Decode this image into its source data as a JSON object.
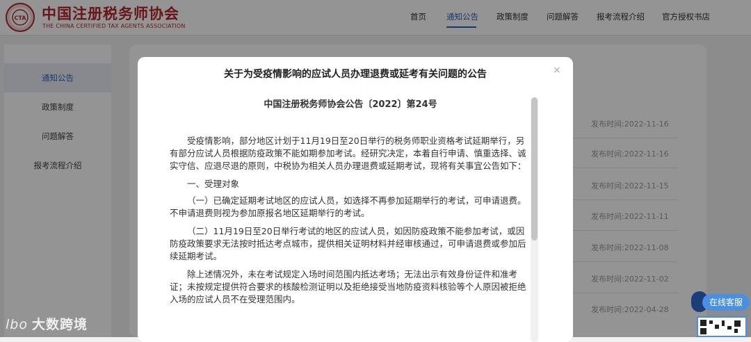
{
  "header": {
    "org_name": "中国注册税务师协会",
    "org_name_en": "THE CHINA CERTIFIED TAX AGENTS ASSOCIATION",
    "logo_text": "CTA",
    "nav": [
      {
        "label": "首页"
      },
      {
        "label": "通知公告",
        "active": true
      },
      {
        "label": "政策制度"
      },
      {
        "label": "问题解答"
      },
      {
        "label": "报考流程介绍"
      },
      {
        "label": "官方授权书店"
      }
    ]
  },
  "sidebar": {
    "items": [
      {
        "label": "通知公告",
        "active": true
      },
      {
        "label": "政策制度"
      },
      {
        "label": "问题解答"
      },
      {
        "label": "报考流程介绍"
      }
    ]
  },
  "list": {
    "dates": [
      "发布时间:2022-11-16",
      "发布时间:2022-11-16",
      "发布时间:2022-11-15",
      "发布时间:2022-11-11",
      "发布时间:2022-11-08",
      "发布时间:2022-11-02",
      "发布时间:2022-04-28"
    ]
  },
  "modal": {
    "title": "关于为受疫情影响的应试人员办理退费或延考有关问题的公告",
    "close_label": "×",
    "doc_number": "中国注册税务师协会公告〔2022〕第24号",
    "paragraphs": [
      "受疫情影响，部分地区计划于11月19日至20日举行的税务师职业资格考试延期举行，另有部分应试人员根据防疫政策不能如期参加考试。经研究决定，本着自行申请、慎重选择、诚实守信、应退尽退的原则，中税协为相关人员办理退费或延期考试，现将有关事宜公告如下：",
      "一、受理对象",
      "（一）已确定延期考试地区的应试人员，如选择不再参加延期举行的考试，可申请退费。不申请退费则视为参加原报名地区延期举行的考试。",
      "（二）11月19日至20日举行考试的地区的应试人员，如因防疫政策不能参加考试，或因防疫政策要求无法按时抵达考点城市，提供相关证明材料并经审核通过，可申请退费或参加后续延期考试。",
      "除上述情况外，未在考试规定入场时间范围内抵达考场；无法出示有效身份证件和准考证；未按规定提供符合要求的核酸检测证明以及拒绝接受当地防疫资料核验等个人原因被拒绝入场的应试人员不在受理范围内。"
    ]
  },
  "watermark": {
    "logo": "lbo",
    "text": "大数跨境"
  },
  "service": {
    "label": "在线客服"
  },
  "colors": {
    "brand_red": "#b3262d",
    "accent_blue": "#2c63b5"
  }
}
